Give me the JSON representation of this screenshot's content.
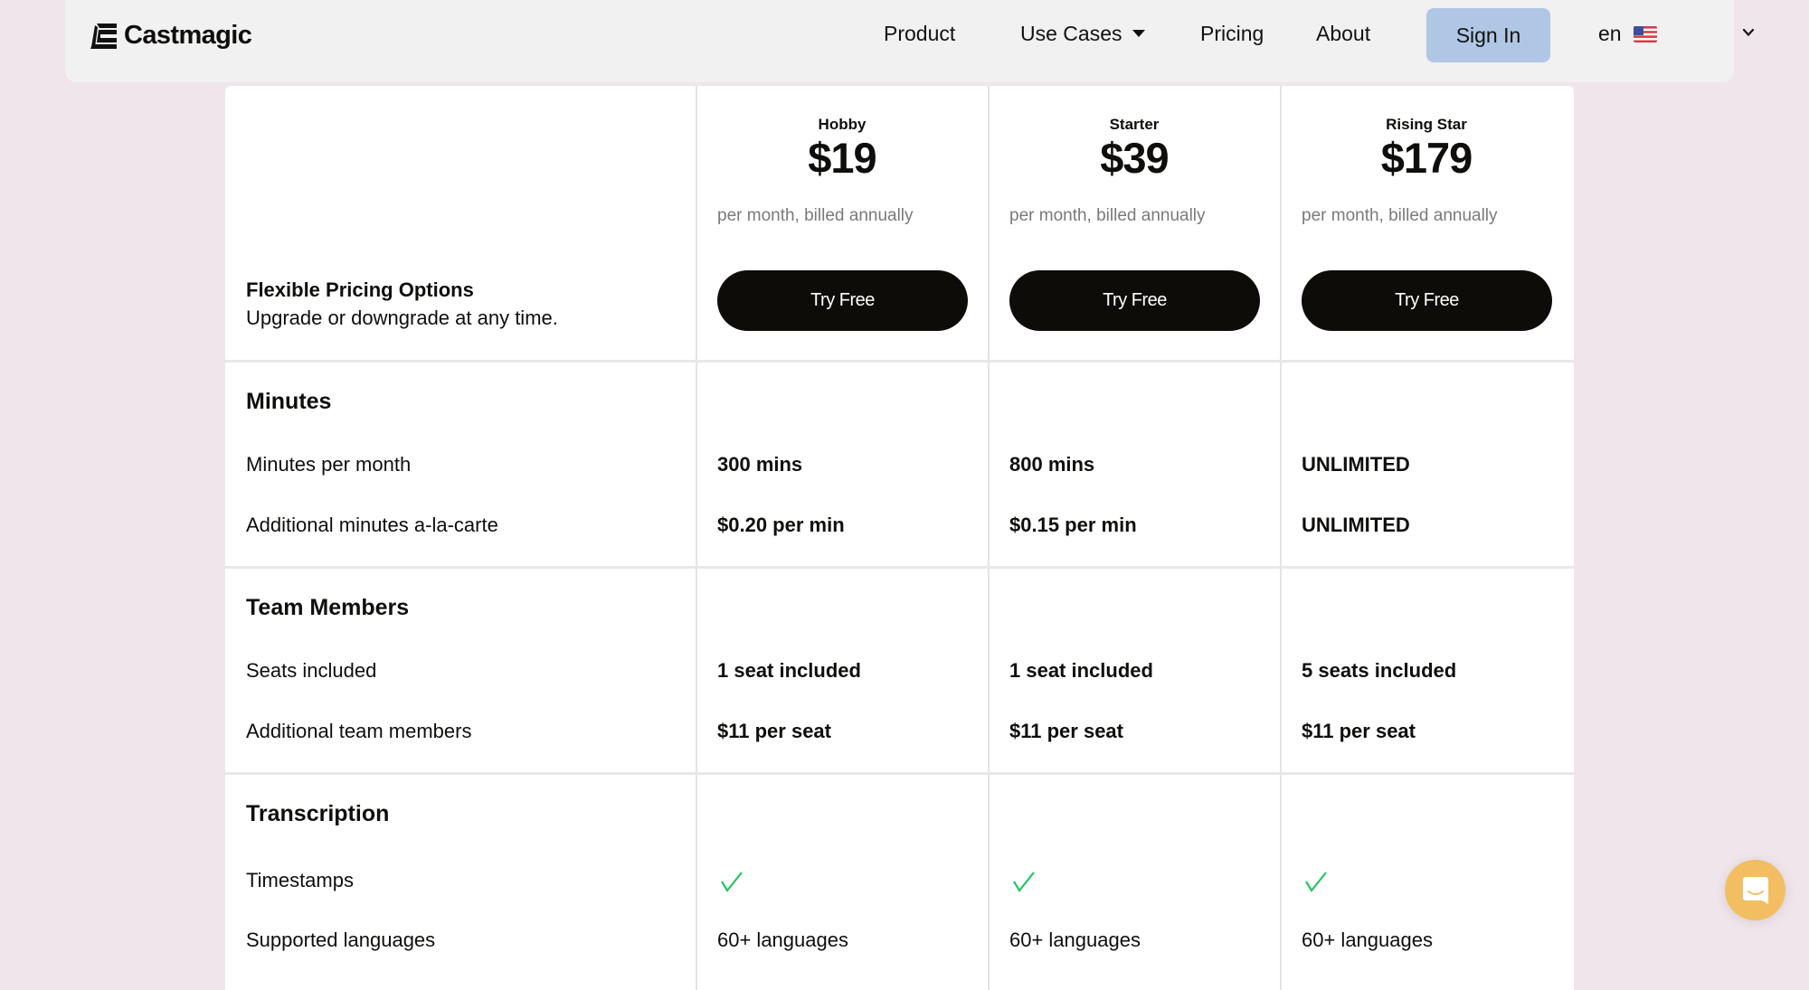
{
  "nav": {
    "brand": "Castmagic",
    "items": [
      "Product",
      "Use Cases",
      "Pricing",
      "About"
    ],
    "signin_label": "Sign In",
    "language": "en",
    "language_flag": "us-flag-icon"
  },
  "intro": {
    "title": "Flexible Pricing Options",
    "subtitle": "Upgrade or downgrade at any time."
  },
  "plans": [
    {
      "name": "Hobby",
      "price": "$19",
      "billing": "per month, billed annually",
      "cta": "Try Free"
    },
    {
      "name": "Starter",
      "price": "$39",
      "billing": "per month, billed annually",
      "cta": "Try Free"
    },
    {
      "name": "Rising Star",
      "price": "$179",
      "billing": "per month, billed annually",
      "cta": "Try Free"
    }
  ],
  "sections": [
    {
      "title": "Minutes",
      "rows": [
        {
          "label": "Minutes per month",
          "values": [
            "300 mins",
            "800 mins",
            "UNLIMITED"
          ]
        },
        {
          "label": "Additional minutes a-la-carte",
          "values": [
            "$0.20 per min",
            "$0.15 per min",
            "UNLIMITED"
          ]
        }
      ]
    },
    {
      "title": "Team Members",
      "rows": [
        {
          "label": "Seats included",
          "values": [
            "1 seat included",
            "1 seat included",
            "5 seats included"
          ]
        },
        {
          "label": "Additional team members",
          "values": [
            "$11 per seat",
            "$11 per seat",
            "$11 per seat"
          ]
        }
      ]
    },
    {
      "title": "Transcription",
      "rows": [
        {
          "label": "Timestamps",
          "values": [
            "check",
            "check",
            "check"
          ]
        },
        {
          "label": "Supported languages",
          "values": [
            "60+ languages",
            "60+ languages",
            "60+ languages"
          ]
        }
      ]
    }
  ],
  "colors": {
    "background": "#efe5eb",
    "navbar": "#f1f1f1",
    "signin_button": "#b0c6e5",
    "cta_button": "#0e0c09",
    "check": "#22c55e",
    "chat_button": "#f3bd62"
  },
  "chat": {
    "icon": "chat-bubble-icon"
  }
}
